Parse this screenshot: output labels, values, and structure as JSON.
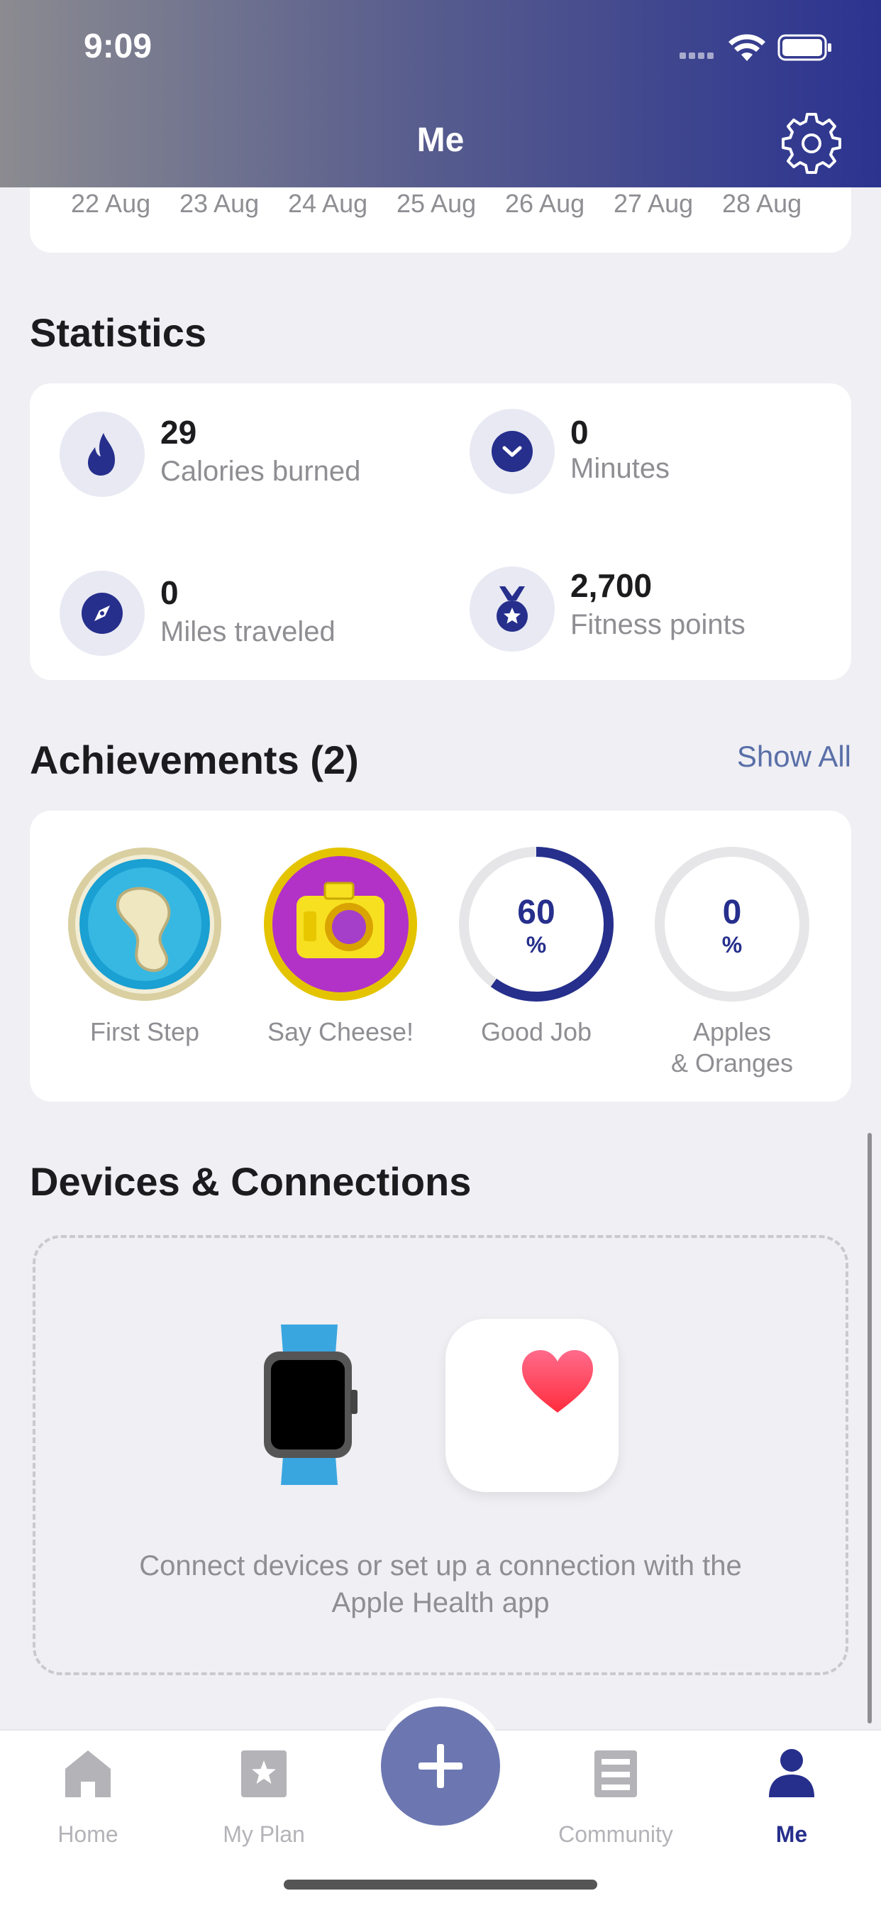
{
  "status_bar": {
    "time": "9:09"
  },
  "header": {
    "title": "Me"
  },
  "date_strip": [
    "22 Aug",
    "23 Aug",
    "24 Aug",
    "25 Aug",
    "26 Aug",
    "27 Aug",
    "28 Aug"
  ],
  "statistics": {
    "title": "Statistics",
    "items": [
      {
        "value": "29",
        "label": "Calories burned",
        "icon": "flame-icon"
      },
      {
        "value": "0",
        "label": "Minutes",
        "icon": "clock-icon"
      },
      {
        "value": "0",
        "label": "Miles traveled",
        "icon": "compass-icon"
      },
      {
        "value": "2,700",
        "label": "Fitness points",
        "icon": "medal-icon"
      }
    ]
  },
  "achievements": {
    "title": "Achievements (2)",
    "show_all": "Show All",
    "items": [
      {
        "label": "First Step",
        "icon": "footprint-badge-icon"
      },
      {
        "label": "Say Cheese!",
        "icon": "camera-badge-icon"
      },
      {
        "label": "Good Job",
        "progress_value": "60",
        "progress_unit": "%",
        "progress": 60
      },
      {
        "label_line1": "Apples",
        "label_line2": "& Oranges",
        "progress_value": "0",
        "progress_unit": "%",
        "progress": 0
      }
    ]
  },
  "devices": {
    "title": "Devices & Connections",
    "text_line1": "Connect devices or set up a connection with the",
    "text_line2": "Apple Health app"
  },
  "tabbar": {
    "tabs": [
      {
        "label": "Home",
        "icon": "home-icon"
      },
      {
        "label": "My Plan",
        "icon": "star-icon"
      },
      {
        "label": "Community",
        "icon": "community-icon"
      },
      {
        "label": "Me",
        "icon": "person-icon",
        "active": true
      }
    ],
    "fab_icon": "plus-icon"
  },
  "colors": {
    "accent": "#262f8c",
    "fab": "#6c77b1",
    "muted_text": "#8e8e93",
    "background": "#efeff4"
  }
}
